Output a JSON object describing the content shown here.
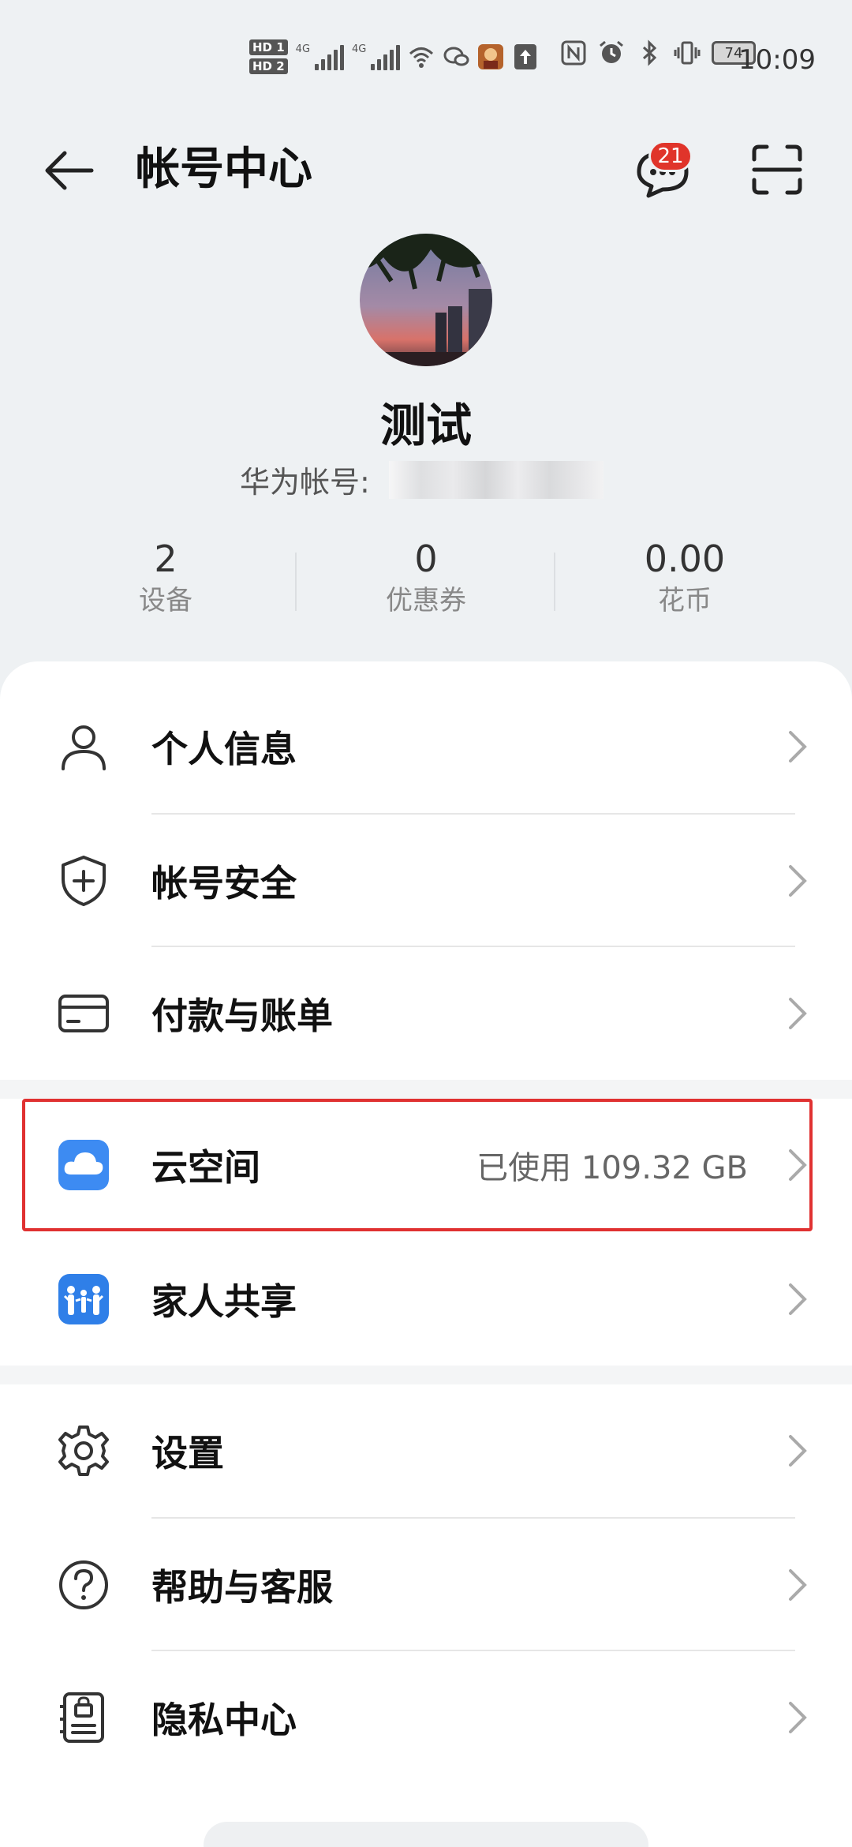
{
  "status_bar": {
    "hd1": "HD 1",
    "hd2": "HD 2",
    "net1": "4G",
    "net2": "4G",
    "battery": "74",
    "time": "10:09"
  },
  "header": {
    "title": "帐号中心",
    "message_badge": "21"
  },
  "profile": {
    "name": "测试",
    "account_label": "华为帐号:"
  },
  "stats": [
    {
      "value": "2",
      "label": "设备"
    },
    {
      "value": "0",
      "label": "优惠券"
    },
    {
      "value": "0.00",
      "label": "花币"
    }
  ],
  "menu": {
    "personal_info": "个人信息",
    "account_security": "帐号安全",
    "payment_bills": "付款与账单",
    "cloud": "云空间",
    "cloud_usage": "已使用 109.32 GB",
    "family_sharing": "家人共享",
    "settings": "设置",
    "help": "帮助与客服",
    "privacy": "隐私中心"
  },
  "colors": {
    "background": "#eef1f3",
    "badge": "#e0342a",
    "highlight": "#e03131",
    "cloud_icon": "#3d8bf2",
    "family_icon": "#2f7fe8"
  },
  "icons": [
    "back-arrow-icon",
    "message-icon",
    "scan-icon",
    "person-icon",
    "shield-plus-icon",
    "card-icon",
    "cloud-icon",
    "family-icon",
    "gear-icon",
    "help-icon",
    "privacy-icon",
    "chevron-right-icon"
  ]
}
